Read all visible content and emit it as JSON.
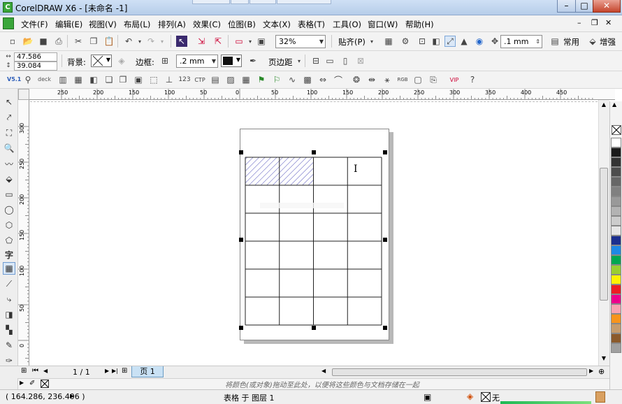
{
  "window": {
    "title": "CorelDRAW X6 - [未命名 -1]",
    "app_logo": "coreldraw-logo-icon",
    "ghost_tabs": [
      "",
      "",
      "",
      ""
    ],
    "buttons": {
      "minimize": "–",
      "maximize": "□",
      "close": "✕"
    }
  },
  "menu": {
    "items": [
      "文件(F)",
      "编辑(E)",
      "视图(V)",
      "布局(L)",
      "排列(A)",
      "效果(C)",
      "位图(B)",
      "文本(X)",
      "表格(T)",
      "工具(O)",
      "窗口(W)",
      "帮助(H)"
    ]
  },
  "toolbar_std": {
    "zoom": "32%",
    "snap_label": "贴齐(P)",
    "nudge": ".1 mm",
    "workspace_label": "常用",
    "enhanced_label": "增强"
  },
  "property_bar": {
    "width": "47.586 mm",
    "height": "39.084 mm",
    "background_label": "背景:",
    "border_label": "边框:",
    "border_width": ".2 mm",
    "page_margin_label": "页边距"
  },
  "toolbar3": {
    "version_label": "V5.1",
    "deck_label": "deck"
  },
  "ruler": {
    "top_labels": [
      "250",
      "200",
      "150",
      "100",
      "50",
      "0",
      "50",
      "100",
      "150",
      "200",
      "250",
      "300",
      "350",
      "400",
      "450"
    ],
    "left_labels": [
      "300",
      "250",
      "200",
      "150",
      "100",
      "50",
      "0"
    ]
  },
  "navigation": {
    "page_count": "1 / 1",
    "page_tab": "页 1"
  },
  "colorbar": {
    "hint": "将颜色(或对象)拖动至此处，以便将这些颜色与文档存储在一起"
  },
  "status": {
    "cursor_coords": "( 164.286, 236.406 )",
    "object_info": "表格 于 图层 1",
    "fill_none": "无"
  },
  "palette_colors": [
    "#ffffff",
    "#1a1a1a",
    "#333333",
    "#4d4d4d",
    "#666666",
    "#808080",
    "#999999",
    "#b3b3b3",
    "#cccccc",
    "#e6e6e6",
    "#1b2f8f",
    "#1e88e5",
    "#00a651",
    "#9acd32",
    "#fff200",
    "#ed1c24",
    "#ec008c",
    "#f9a3b1",
    "#f7941d",
    "#c69c6d",
    "#8b5a2b",
    "#a0a0a0"
  ],
  "table": {
    "rows": 6,
    "cols": 4,
    "hatched_cells": [
      [
        0,
        0
      ],
      [
        0,
        1
      ]
    ]
  }
}
